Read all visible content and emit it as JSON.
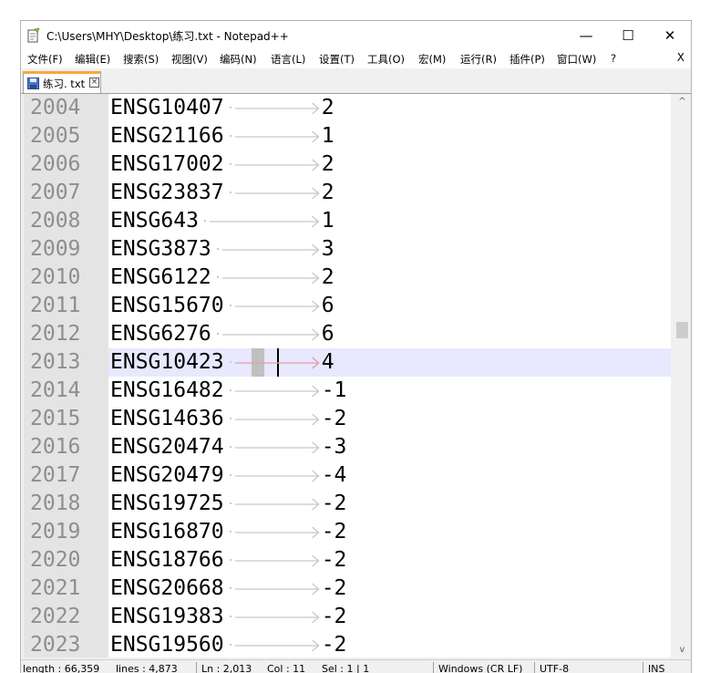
{
  "window": {
    "title": "C:\\Users\\MHY\\Desktop\\练习.txt - Notepad++",
    "minimize_glyph": "—",
    "maximize_glyph": "☐",
    "close_glyph": "✕"
  },
  "menu": {
    "items": [
      "文件(F)",
      "编辑(E)",
      "搜索(S)",
      "视图(V)",
      "编码(N)",
      "语言(L)",
      "设置(T)",
      "工具(O)",
      "宏(M)",
      "运行(R)",
      "插件(P)",
      "窗口(W)",
      "?"
    ],
    "close_label": "X"
  },
  "tab": {
    "label": "练习. txt",
    "close_glyph": "×"
  },
  "editor": {
    "current_line": 2013,
    "lines": [
      {
        "num": "2004",
        "gene": "ENSG10407",
        "value": "2"
      },
      {
        "num": "2005",
        "gene": "ENSG21166",
        "value": "1"
      },
      {
        "num": "2006",
        "gene": "ENSG17002",
        "value": "2"
      },
      {
        "num": "2007",
        "gene": "ENSG23837",
        "value": "2"
      },
      {
        "num": "2008",
        "gene": "ENSG643",
        "value": "1"
      },
      {
        "num": "2009",
        "gene": "ENSG3873",
        "value": "3"
      },
      {
        "num": "2010",
        "gene": "ENSG6122",
        "value": "2"
      },
      {
        "num": "2011",
        "gene": "ENSG15670",
        "value": "6"
      },
      {
        "num": "2012",
        "gene": "ENSG6276",
        "value": "6"
      },
      {
        "num": "2013",
        "gene": "ENSG10423",
        "value": "4"
      },
      {
        "num": "2014",
        "gene": "ENSG16482",
        "value": "-1"
      },
      {
        "num": "2015",
        "gene": "ENSG14636",
        "value": "-2"
      },
      {
        "num": "2016",
        "gene": "ENSG20474",
        "value": "-3"
      },
      {
        "num": "2017",
        "gene": "ENSG20479",
        "value": "-4"
      },
      {
        "num": "2018",
        "gene": "ENSG19725",
        "value": "-2"
      },
      {
        "num": "2019",
        "gene": "ENSG16870",
        "value": "-2"
      },
      {
        "num": "2020",
        "gene": "ENSG18766",
        "value": "-2"
      },
      {
        "num": "2021",
        "gene": "ENSG20668",
        "value": "-2"
      },
      {
        "num": "2022",
        "gene": "ENSG19383",
        "value": "-2"
      },
      {
        "num": "2023",
        "gene": "ENSG19560",
        "value": "-2"
      }
    ]
  },
  "scrollbar": {
    "up_glyph": "^",
    "down_glyph": "v"
  },
  "status": {
    "length": "length : 66,359",
    "lines": "lines : 4,873",
    "ln": "Ln : 2,013",
    "col": "Col : 11",
    "sel": "Sel : 1 | 1",
    "eol": "Windows (CR LF)",
    "encoding": "UTF-8",
    "mode": "INS"
  },
  "colors": {
    "line_number_gutter": "#e4e4e4",
    "current_line_highlight": "#e8e8ff",
    "tab_accent": "#f9a640",
    "whitespace_marker": "#c8c8c8"
  }
}
